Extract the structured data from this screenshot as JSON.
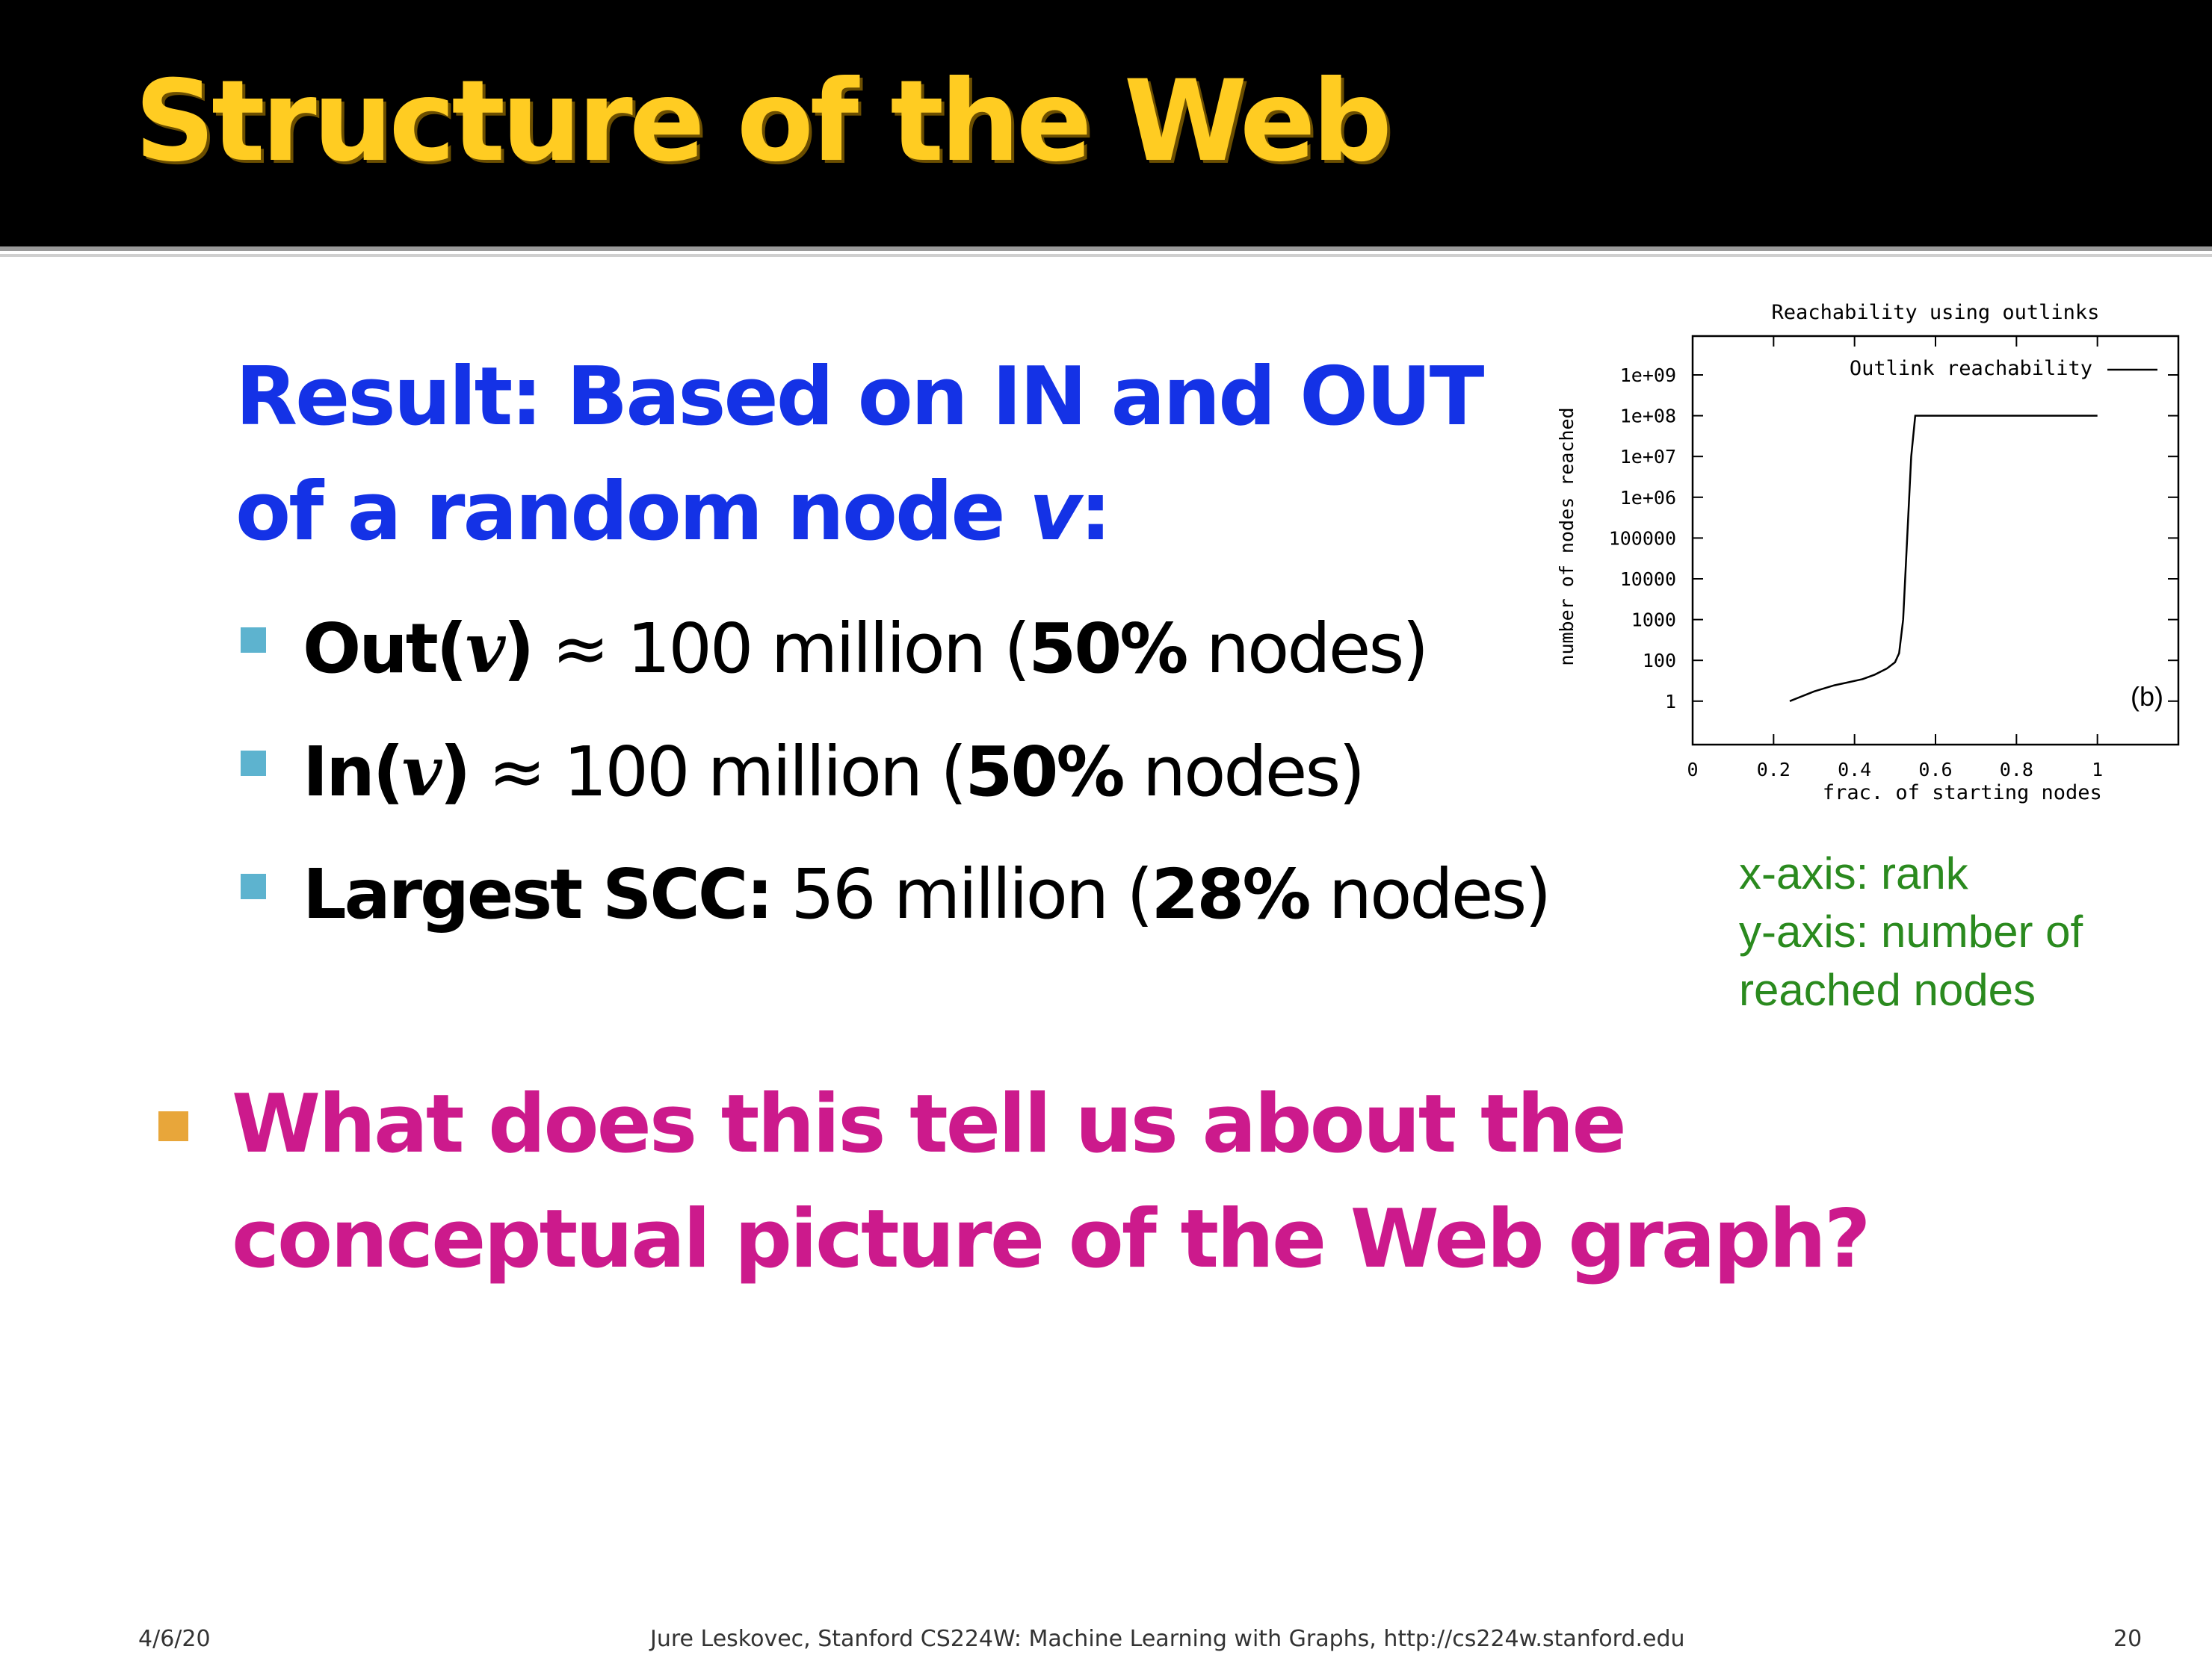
{
  "slide": {
    "title": "Structure of the Web",
    "result_line1": "Result: Based on IN and OUT",
    "result_line2_prefix": "of a random node ",
    "result_line2_var": "v",
    "result_line2_suffix": ":",
    "bullets": [
      {
        "label": "Out(",
        "var": "v",
        "label_close": ")",
        "approx": " ≈ 100 million  (",
        "pct": "50%",
        "tail": " nodes)"
      },
      {
        "label": "In(",
        "var": "v",
        "label_close": ")",
        "approx": " ≈ 100 million  (",
        "pct": "50%",
        "tail": " nodes)"
      },
      {
        "label": "Largest SCC:",
        "var": "",
        "label_close": "",
        "approx": " 56 million (",
        "pct": "28%",
        "tail": " nodes)"
      }
    ],
    "question_line1": "What does this tell us about the",
    "question_line2": "conceptual picture of the Web graph?",
    "axis_notes": [
      "x-axis: rank",
      "y-axis: number of",
      "reached nodes"
    ]
  },
  "footer": {
    "date": "4/6/20",
    "credit": "Jure Leskovec, Stanford CS224W: Machine Learning with Graphs, http://cs224w.stanford.edu",
    "page": "20"
  },
  "colors": {
    "title": "#ffcc22",
    "result": "#1432e6",
    "question": "#cc1a8c",
    "axis_note": "#2a8a1e",
    "sub_bullet": "#5db3cf",
    "main_bullet": "#e8a63a"
  },
  "chart_data": {
    "type": "line",
    "title": "Reachability using outlinks",
    "xlabel": "frac. of starting nodes",
    "ylabel": "number of nodes reached",
    "panel_label": "(b)",
    "xlim": [
      0,
      1.2
    ],
    "ylim": [
      1,
      1000000000
    ],
    "y_scale": "log",
    "x_ticks": [
      0,
      0.2,
      0.4,
      0.6,
      0.8,
      1
    ],
    "x_tick_labels": [
      "0",
      "0.2",
      "0.4",
      "0.6",
      "0.8",
      "1"
    ],
    "y_ticks": [
      1,
      100,
      1000,
      10000,
      100000,
      1000000,
      10000000,
      100000000,
      1000000000
    ],
    "y_tick_labels": [
      "1",
      "100",
      "1000",
      "10000",
      "100000",
      "1e+06",
      "1e+07",
      "1e+08",
      "1e+09"
    ],
    "legend_position": "top-right",
    "series": [
      {
        "name": "Outlink reachability",
        "x": [
          0.24,
          0.3,
          0.35,
          0.38,
          0.42,
          0.45,
          0.48,
          0.5,
          0.51,
          0.52,
          0.53,
          0.54,
          0.55,
          1.0
        ],
        "y": [
          1,
          3,
          6,
          8,
          12,
          20,
          40,
          80,
          150,
          1000,
          100000,
          10000000,
          100000000,
          100000000
        ]
      }
    ]
  }
}
